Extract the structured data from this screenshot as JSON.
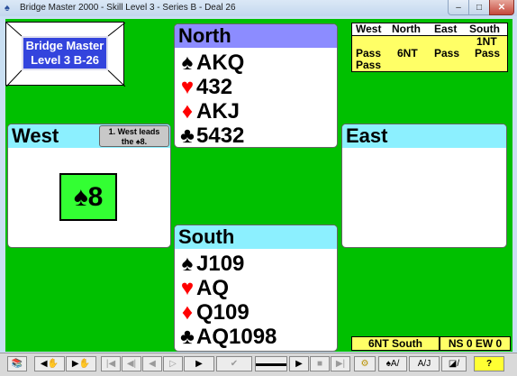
{
  "window": {
    "title": "Bridge Master 2000 - Skill Level 3 - Series B - Deal 26",
    "min_label": "–",
    "max_label": "□",
    "close_label": "✕"
  },
  "logo": {
    "line1": "Bridge Master",
    "line2": "Level 3 B-26"
  },
  "north": {
    "name": "North",
    "rows": [
      {
        "suit": "♠",
        "cards": "AKQ",
        "color": "#000000"
      },
      {
        "suit": "♥",
        "cards": "432",
        "color": "#ff0000"
      },
      {
        "suit": "♦",
        "cards": "AKJ",
        "color": "#ff0000"
      },
      {
        "suit": "♣",
        "cards": "5432",
        "color": "#000000"
      }
    ]
  },
  "south": {
    "name": "South",
    "rows": [
      {
        "suit": "♠",
        "cards": "J109",
        "color": "#000000"
      },
      {
        "suit": "♥",
        "cards": "AQ",
        "color": "#ff0000"
      },
      {
        "suit": "♦",
        "cards": "Q109",
        "color": "#ff0000"
      },
      {
        "suit": "♣",
        "cards": "AQ1098",
        "color": "#000000"
      }
    ]
  },
  "west": {
    "name": "West"
  },
  "east": {
    "name": "East"
  },
  "note": {
    "line1": "1. West leads",
    "line2_prefix": "the ",
    "line2_suit": "♠",
    "line2_rank": "8."
  },
  "played_card": {
    "suit": "♠",
    "rank": "8"
  },
  "bidding": {
    "headers": [
      "West",
      "North",
      "East",
      "South"
    ],
    "row1": [
      "",
      "",
      "",
      "1NT"
    ],
    "row2": [
      "Pass",
      "6NT",
      "Pass",
      "Pass"
    ],
    "row3": [
      "Pass",
      "",
      "",
      ""
    ]
  },
  "contract": "6NT South",
  "score": "NS 0  EW 0",
  "toolbar": {
    "deal_icon": "📚",
    "prev": "◀",
    "prev_hand": "✋",
    "next": "▶",
    "next_hand": "✋",
    "dim1": "|◀",
    "dim2": "◀|",
    "dim3": "◀",
    "dim4": "▷",
    "next_card": "▶",
    "tick": "✔",
    "keyboard": "▬▬▬▬",
    "play": "▶",
    "stop": "■",
    "end": "▶|",
    "settings_icon": "⚙",
    "claim": "♠A/",
    "aj": "A/J",
    "concede": "◪/",
    "help": "?"
  },
  "colors": {
    "felt": "#00c000",
    "north_header": "#8c8cff",
    "light_header": "#8cf0ff",
    "bid_box": "#ffff66",
    "played_card": "#33ff33"
  }
}
